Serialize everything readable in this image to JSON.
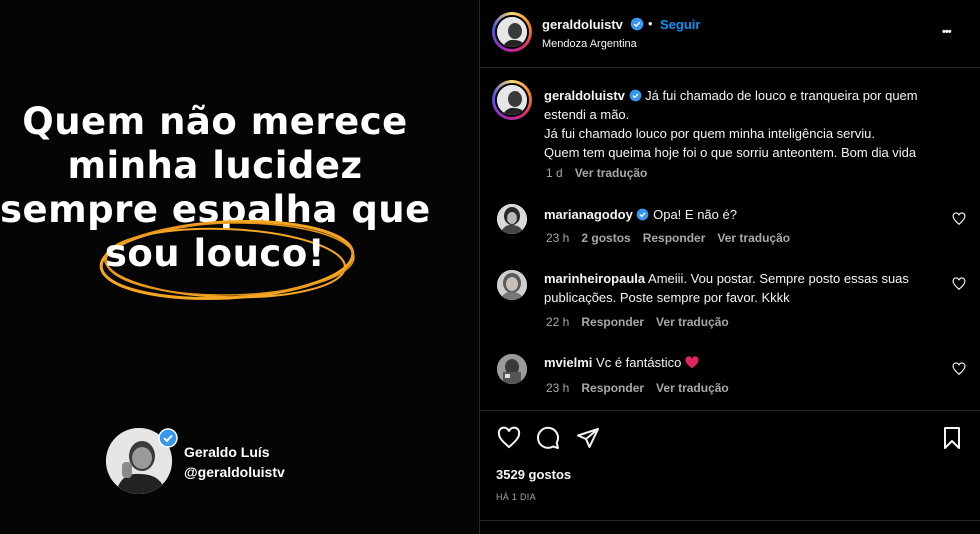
{
  "post_image": {
    "quote_lines": [
      "Quem não merece",
      "minha lucidez",
      "sempre espalha que",
      "sou louco!"
    ],
    "card_name": "Geraldo Luís",
    "card_handle": "@geraldoluistv"
  },
  "header": {
    "username": "geraldoluistv",
    "dot": "•",
    "follow_label": "Seguir",
    "location": "Mendoza Argentina",
    "more_label": "•••"
  },
  "caption": {
    "username": "geraldoluistv",
    "lines": [
      "Já fui chamado de louco e tranqueira por quem",
      "estendi a mão.",
      "Já fui chamado louco por quem minha inteligência serviu.",
      "Quem tem queima hoje foi o que sorriu anteontem. Bom dia vida"
    ],
    "time": "1 d",
    "translate": "Ver tradução"
  },
  "comments": [
    {
      "username": "marianagodoy",
      "verified": true,
      "text_lines": [
        "Opa! E não é?"
      ],
      "time": "23 h",
      "likes": "2 gostos",
      "reply": "Responder",
      "translate": "Ver tradução"
    },
    {
      "username": "marinheiropaula",
      "verified": false,
      "text_lines": [
        "Ameiii. Vou postar. Sempre posto essas suas",
        "publicações. Poste sempre por favor. Kkkk"
      ],
      "time": "22 h",
      "likes": "",
      "reply": "Responder",
      "translate": "Ver tradução"
    },
    {
      "username": "mvielmi",
      "verified": false,
      "text_lines": [
        "Vc é fantástico"
      ],
      "emoji": "heart",
      "time": "23 h",
      "likes": "",
      "reply": "Responder",
      "translate": "Ver tradução"
    }
  ],
  "actions": {
    "likes_count": "3529 gostos",
    "posted_ago": "HÁ 1 DIA"
  },
  "colors": {
    "accent_blue": "#0095f6",
    "verified_blue": "#3897f0",
    "ellipse_orange": "#f5a623",
    "heart_red": "#e0245e"
  }
}
